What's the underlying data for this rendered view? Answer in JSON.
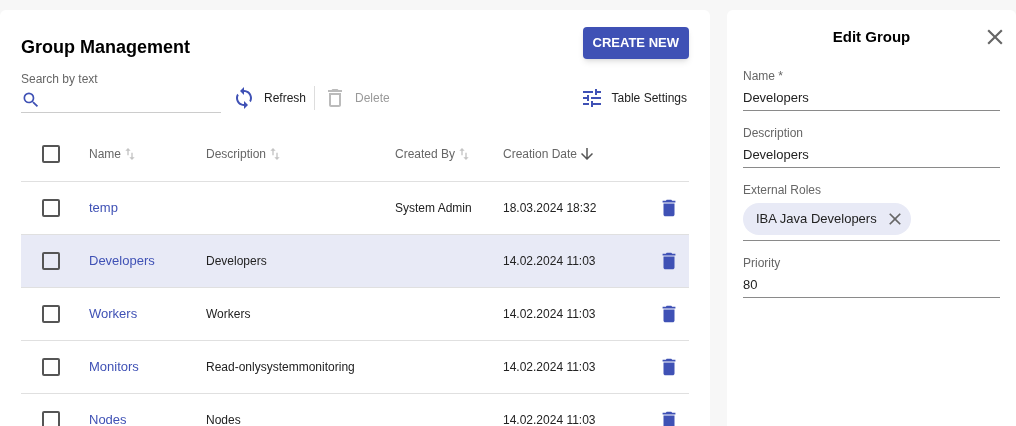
{
  "page": {
    "title": "Group Management",
    "create_button": "CREATE NEW"
  },
  "search": {
    "label": "Search by text"
  },
  "toolbar": [
    {
      "label": "Refresh",
      "kind": "refresh",
      "disabled": false
    },
    {
      "label": "Delete",
      "kind": "delete",
      "disabled": true
    },
    {
      "label": "Table Settings",
      "kind": "settings",
      "disabled": false
    }
  ],
  "table": {
    "columns": [
      {
        "label": "Name",
        "sorted": false
      },
      {
        "label": "Description",
        "sorted": false
      },
      {
        "label": "Created By",
        "sorted": false
      },
      {
        "label": "Creation Date",
        "sorted": true
      }
    ],
    "header_checked": false,
    "rows": [
      {
        "name": "temp",
        "created_by": "System Admin",
        "creation_date": "18.03.2024 18:32",
        "selected": false,
        "checked": false
      },
      {
        "name": "Developers",
        "description": "Developers",
        "creation_date": "14.02.2024 11:03",
        "selected": true,
        "checked": false
      },
      {
        "name": "Workers",
        "description": "Workers",
        "creation_date": "14.02.2024 11:03",
        "selected": false,
        "checked": false
      },
      {
        "name": "Monitors",
        "description": "Read-onlysystemmonitoring",
        "creation_date": "14.02.2024 11:03",
        "selected": false,
        "checked": false
      },
      {
        "name": "Nodes",
        "description": "Nodes",
        "creation_date": "14.02.2024 11:03",
        "selected": false,
        "checked": false
      }
    ]
  },
  "edit_panel": {
    "title": "Edit Group",
    "fields": [
      {
        "label": "Name *",
        "kind": "text",
        "value": "Developers"
      },
      {
        "label": "Description",
        "kind": "text",
        "value": "Developers"
      },
      {
        "label": "External Roles",
        "kind": "chips",
        "chips": [
          "IBA Java Developers"
        ]
      },
      {
        "label": "Priority",
        "kind": "text",
        "value": "80"
      }
    ]
  }
}
